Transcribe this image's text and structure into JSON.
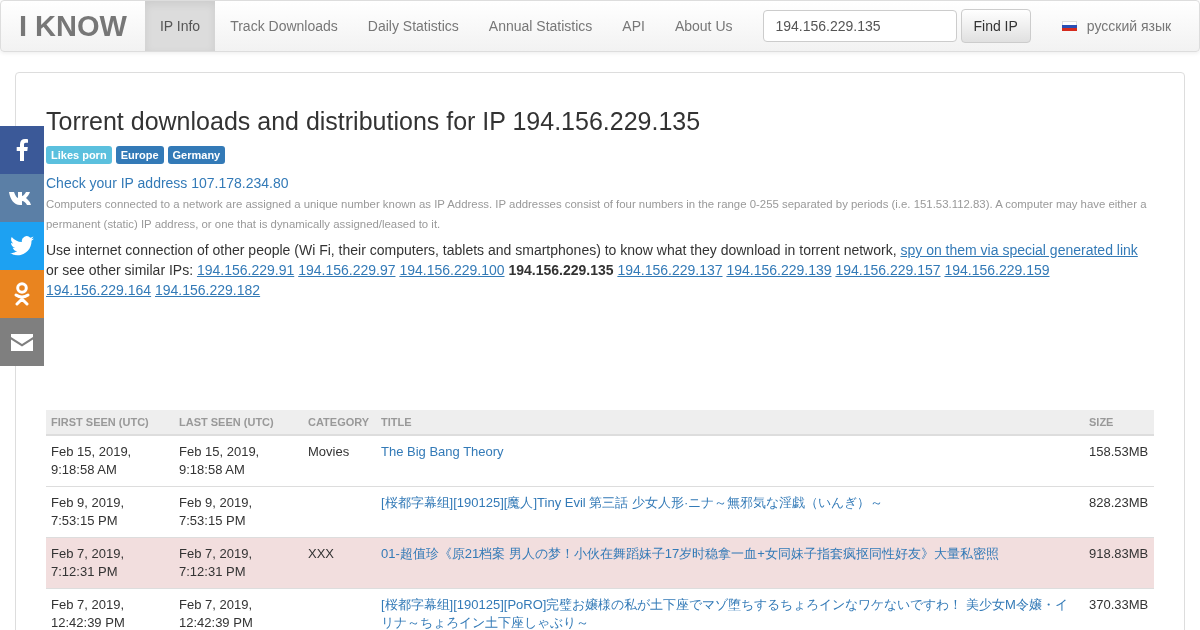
{
  "navbar": {
    "brand": "I KNOW",
    "items": [
      {
        "label": "IP Info",
        "selected": true
      },
      {
        "label": "Track Downloads",
        "selected": false
      },
      {
        "label": "Daily Statistics",
        "selected": false
      },
      {
        "label": "Annual Statistics",
        "selected": false
      },
      {
        "label": "API",
        "selected": false
      },
      {
        "label": "About Us",
        "selected": false
      }
    ],
    "search": {
      "value": "194.156.229.135",
      "button": "Find IP"
    },
    "language": "русский язык"
  },
  "share_buttons": [
    {
      "kind": "facebook",
      "color": "#3b5998"
    },
    {
      "kind": "vk",
      "color": "#5b7fa6"
    },
    {
      "kind": "twitter",
      "color": "#1da1f2"
    },
    {
      "kind": "ok",
      "color": "#e9841f"
    },
    {
      "kind": "mail",
      "color": "#7f7f7f"
    }
  ],
  "heading": "Torrent downloads and distributions for IP 194.156.229.135",
  "tags": [
    {
      "label": "Likes porn",
      "color": "#5bc0de"
    },
    {
      "label": "Europe",
      "color": "#337ab7"
    },
    {
      "label": "Germany",
      "color": "#337ab7"
    }
  ],
  "check_link": "Check your IP address 107.178.234.80",
  "description": "Computers connected to a network are assigned a unique number known as IP Address. IP addresses consist of four numbers in the range 0-255 separated by periods (i.e. 151.53.112.83). A computer may have either a permanent (static) IP address, or one that is dynamically assigned/leased to it.",
  "spy": {
    "text": "Use internet connection of other people (Wi Fi, their computers, tablets and smartphones) to know what they download in torrent network,",
    "link": "spy on them via special generated link",
    "similar_label": "or see other similar IPs:"
  },
  "similar_ips": [
    {
      "ip": "194.156.229.91",
      "selected": false
    },
    {
      "ip": "194.156.229.97",
      "selected": false
    },
    {
      "ip": "194.156.229.100",
      "selected": false
    },
    {
      "ip": "194.156.229.135",
      "selected": true
    },
    {
      "ip": "194.156.229.137",
      "selected": false
    },
    {
      "ip": "194.156.229.139",
      "selected": false
    },
    {
      "ip": "194.156.229.157",
      "selected": false
    },
    {
      "ip": "194.156.229.159",
      "selected": false
    },
    {
      "ip": "194.156.229.164",
      "selected": false
    },
    {
      "ip": "194.156.229.182",
      "selected": false
    }
  ],
  "table": {
    "columns": [
      "FIRST SEEN (UTC)",
      "LAST SEEN (UTC)",
      "CATEGORY",
      "TITLE",
      "SIZE"
    ],
    "rows": [
      {
        "first_seen": "Feb 15, 2019, 9:18:58 AM",
        "last_seen": "Feb 15, 2019, 9:18:58 AM",
        "category": "Movies",
        "title": "The Big Bang Theory",
        "size": "158.53MB",
        "highlighted": false
      },
      {
        "first_seen": "Feb 9, 2019, 7:53:15 PM",
        "last_seen": "Feb 9, 2019, 7:53:15 PM",
        "title": "[桜都字幕组][190125][魔人]Tiny Evil 第三話 少女人形·ニナ～無邪気な淫戯（いんぎ）～",
        "size": "828.23MB",
        "highlighted": false
      },
      {
        "first_seen": "Feb 7, 2019, 7:12:31 PM",
        "last_seen": "Feb 7, 2019, 7:12:31 PM",
        "category": "XXX",
        "title": "01-超值珍《原21档案 男人の梦！小伙在舞蹈妹子17岁时稳拿一血+女同妹子指套疯抠同性好友》大量私密照",
        "size": "918.83MB",
        "highlighted": true
      },
      {
        "first_seen": "Feb 7, 2019, 12:42:39 PM",
        "last_seen": "Feb 7, 2019, 12:42:39 PM",
        "title": "[桜都字幕组][190125][PoRO]完璧お嬢様の私が土下座でマゾ堕ちするちょろインなワケないですわ！ 美少女M令嬢・イリナ～ちょろイン土下座しゃぶり～",
        "size": "370.33MB",
        "highlighted": false
      }
    ]
  }
}
